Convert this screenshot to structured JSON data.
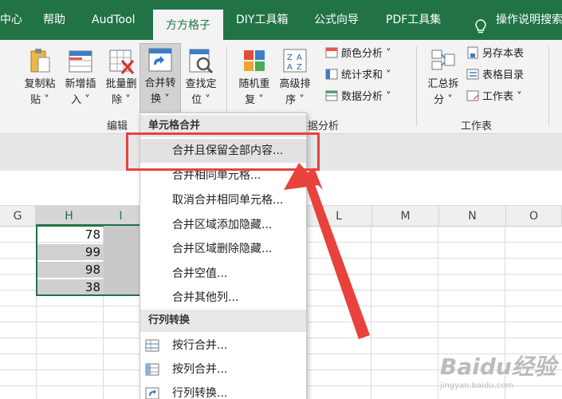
{
  "tabs": [
    {
      "label": "中心"
    },
    {
      "label": "帮助"
    },
    {
      "label": "AudTool"
    },
    {
      "label": "方方格子",
      "active": true
    },
    {
      "label": "DIY工具箱"
    },
    {
      "label": "公式向导"
    },
    {
      "label": "PDF工具集"
    }
  ],
  "tell_me": "操作说明搜索",
  "ribbon": {
    "buttons": [
      {
        "line1": "复制粘",
        "line2": "贴 ˅"
      },
      {
        "line1": "新增插",
        "line2": "入 ˅"
      },
      {
        "line1": "批量删",
        "line2": "除 ˅"
      },
      {
        "line1": "合并转",
        "line2": "换 ˅"
      },
      {
        "line1": "查找定",
        "line2": "位 ˅"
      },
      {
        "line1": "随机重",
        "line2": "复 ˅"
      },
      {
        "line1": "高级排",
        "line2": "序 ˅"
      },
      {
        "line1": "汇总拆",
        "line2": "分 ˅"
      }
    ],
    "small": {
      "color_analysis": "颜色分析 ˅",
      "stats_sum": "统计求和 ˅",
      "data_analysis": "数据分析 ˅",
      "save_sheet": "另存本表",
      "sheet_dir": "表格目录",
      "worksheet": "工作表 ˅"
    },
    "groups": {
      "edit": "编辑",
      "data_analysis": "据分析",
      "worksheet": "工作表"
    }
  },
  "columns": [
    "G",
    "H",
    "I",
    "L",
    "M",
    "N",
    "O"
  ],
  "cells": [
    "78",
    "99",
    "98",
    "38"
  ],
  "menu": {
    "section1": "单元格合并",
    "items1": [
      "合并且保留全部内容...",
      "合并相同单元格...",
      "取消合并相同单元格...",
      "合并区域添加隐藏...",
      "合并区域删除隐藏...",
      "合并空值...",
      "合并其他列..."
    ],
    "section2": "行列转换",
    "items2": [
      "按行合并...",
      "按列合并...",
      "行列转换..."
    ]
  },
  "watermark": {
    "brand": "Baidu经验",
    "url": "jingyan.baidu.com"
  },
  "colors": {
    "excel_green": "#217346",
    "callout_red": "#e8423c"
  }
}
